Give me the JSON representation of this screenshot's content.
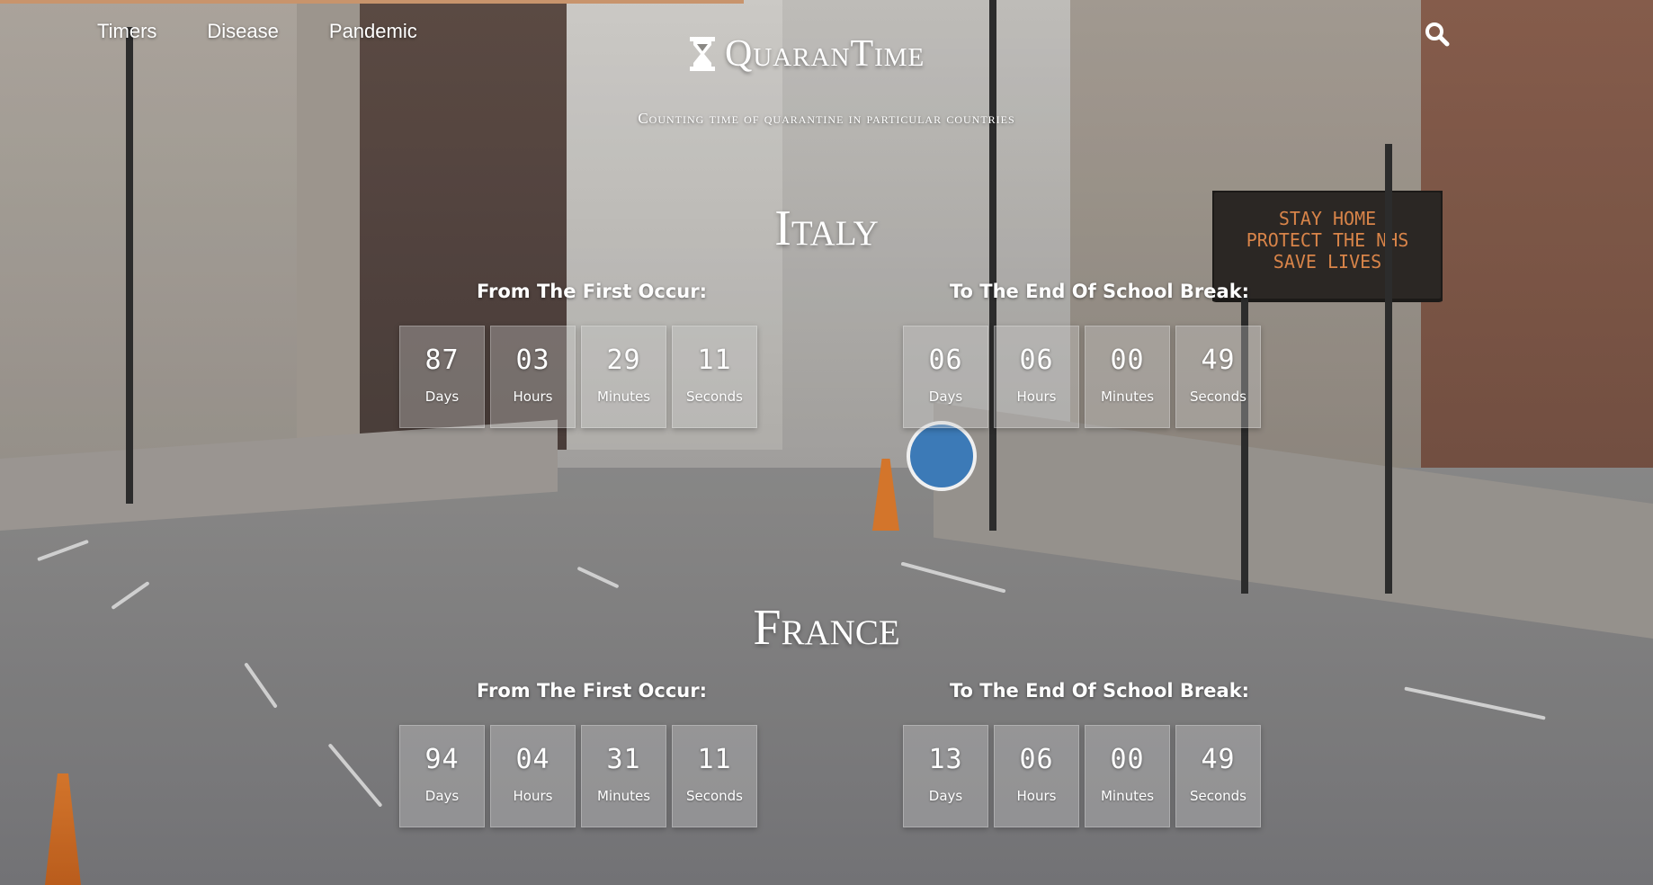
{
  "nav": {
    "items": [
      "Timers",
      "Disease",
      "Pandemic"
    ]
  },
  "brand": {
    "name": "QuaranTime",
    "subtitle": "Counting time of quarantine in particular countries",
    "icon": "hourglass-icon"
  },
  "search": {
    "icon": "search-icon"
  },
  "page_progress": {
    "fraction": 0.45
  },
  "countries": [
    {
      "name": "Italy",
      "first": {
        "label": "From The First Occur:",
        "units": [
          {
            "value": "87",
            "unit": "Days"
          },
          {
            "value": "03",
            "unit": "Hours"
          },
          {
            "value": "29",
            "unit": "Minutes"
          },
          {
            "value": "11",
            "unit": "Seconds"
          }
        ]
      },
      "end": {
        "label": "To The End Of School Break:",
        "units": [
          {
            "value": "06",
            "unit": "Days"
          },
          {
            "value": "06",
            "unit": "Hours"
          },
          {
            "value": "00",
            "unit": "Minutes"
          },
          {
            "value": "49",
            "unit": "Seconds"
          }
        ]
      }
    },
    {
      "name": "France",
      "first": {
        "label": "From The First Occur:",
        "units": [
          {
            "value": "94",
            "unit": "Days"
          },
          {
            "value": "04",
            "unit": "Hours"
          },
          {
            "value": "31",
            "unit": "Minutes"
          },
          {
            "value": "11",
            "unit": "Seconds"
          }
        ]
      },
      "end": {
        "label": "To The End Of School Break:",
        "units": [
          {
            "value": "13",
            "unit": "Days"
          },
          {
            "value": "06",
            "unit": "Hours"
          },
          {
            "value": "00",
            "unit": "Minutes"
          },
          {
            "value": "49",
            "unit": "Seconds"
          }
        ]
      }
    }
  ],
  "background": {
    "sign_text": [
      "STAY HOME",
      "PROTECT THE NHS",
      "SAVE LIVES"
    ]
  },
  "colors": {
    "progress": "#c8946c",
    "text": "#ffffff"
  }
}
